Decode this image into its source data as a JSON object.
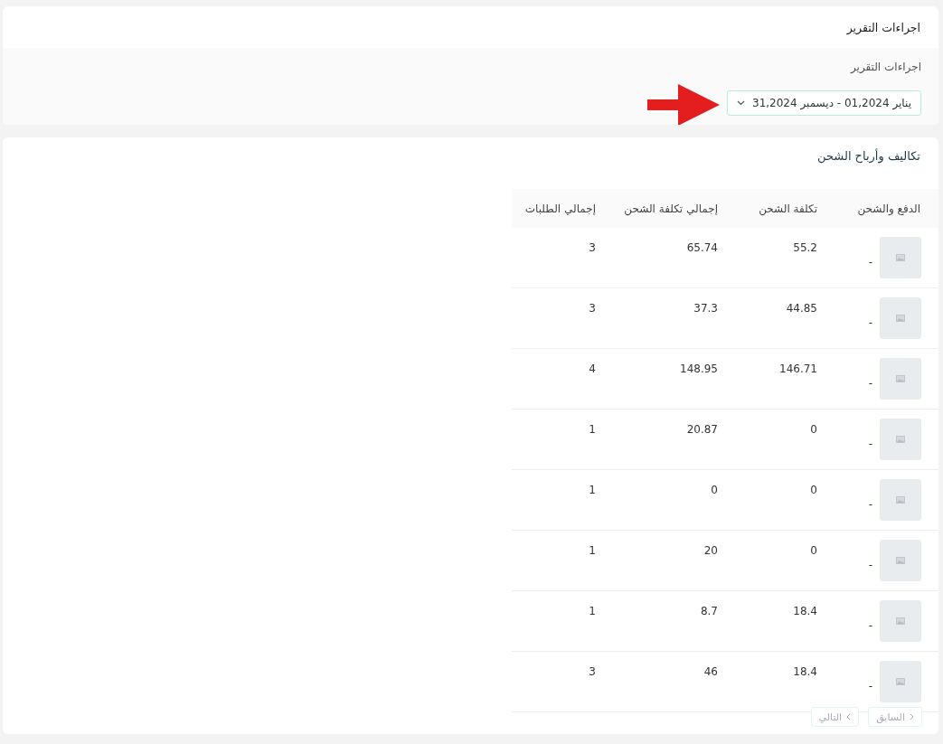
{
  "actions_card": {
    "title": "اجراءات التقرير",
    "field_label": "اجراءات التقرير",
    "date_range": "يناير 01,2024 - ديسمبر 31,2024"
  },
  "table_card": {
    "title": "تكاليف وأرباح الشحن",
    "columns": [
      "الدفع والشحن",
      "تكلفة الشحن",
      "إجمالي تكلفة الشحن",
      "إجمالي الطلبات"
    ],
    "rows": [
      {
        "method": "-",
        "shipping_cost": "55.2",
        "total_shipping_cost": "65.74",
        "total_orders": "3"
      },
      {
        "method": "-",
        "shipping_cost": "44.85",
        "total_shipping_cost": "37.3",
        "total_orders": "3"
      },
      {
        "method": "-",
        "shipping_cost": "146.71",
        "total_shipping_cost": "148.95",
        "total_orders": "4"
      },
      {
        "method": "-",
        "shipping_cost": "0",
        "total_shipping_cost": "20.87",
        "total_orders": "1"
      },
      {
        "method": "-",
        "shipping_cost": "0",
        "total_shipping_cost": "0",
        "total_orders": "1"
      },
      {
        "method": "-",
        "shipping_cost": "0",
        "total_shipping_cost": "20",
        "total_orders": "1"
      },
      {
        "method": "-",
        "shipping_cost": "18.4",
        "total_shipping_cost": "8.7",
        "total_orders": "1"
      },
      {
        "method": "-",
        "shipping_cost": "18.4",
        "total_shipping_cost": "46",
        "total_orders": "3"
      }
    ],
    "pagination": [
      {
        "label": "السابق",
        "kind": "prev",
        "disabled": true
      },
      {
        "label": "التالي",
        "kind": "next",
        "disabled": true
      }
    ]
  }
}
